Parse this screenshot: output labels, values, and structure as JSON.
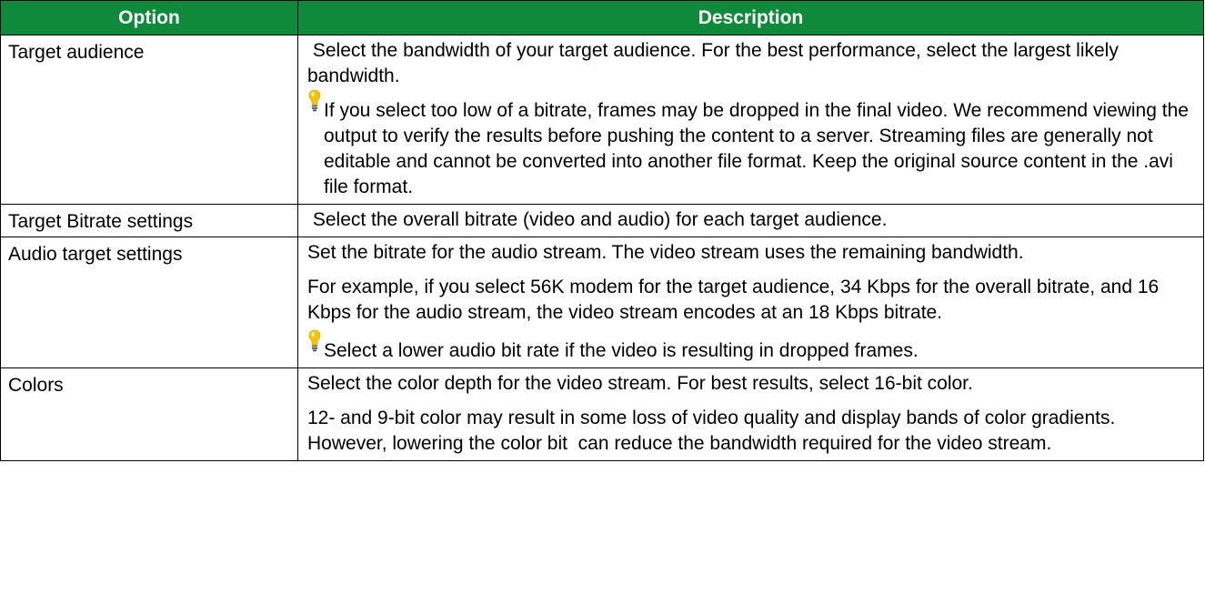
{
  "header": {
    "option": "Option",
    "description": "Description"
  },
  "rows": [
    {
      "option": "Target audience",
      "paragraphs": [
        " Select the bandwidth of your target audience. For the best performance, select the largest likely bandwidth."
      ],
      "tip": "If you select too low of a bitrate, frames may be dropped in the final video. We recommend viewing the output to verify the results before pushing the content to a server. Streaming files are generally not editable and cannot be converted into another file format. Keep the original source content in the .avi file format."
    },
    {
      "option": "Target Bitrate settings",
      "paragraphs": [
        " Select the overall bitrate (video and audio) for each target audience."
      ]
    },
    {
      "option": "Audio target settings",
      "paragraphs": [
        "Set the bitrate for the audio stream. The video stream uses the remaining bandwidth.",
        "For example, if you select 56K modem for the target audience, 34 Kbps for the overall bitrate, and 16 Kbps for the audio stream, the video stream encodes at an 18 Kbps bitrate."
      ],
      "tip": "Select a lower audio bit rate if the video is resulting in dropped frames."
    },
    {
      "option": "Colors",
      "paragraphs": [
        "Select the color depth for the video stream. For best results, select 16-bit color.",
        "12- and 9-bit color may result in some loss of video quality and display bands of color gradients. However, lowering the color bit  can reduce the bandwidth required for the video stream."
      ]
    }
  ],
  "colors": {
    "header_bg": "#0f8a3b",
    "header_text": "#ffffff",
    "border": "#000000",
    "tip_bulb": "#f2c500"
  },
  "icons": {
    "tip": "lightbulb-icon"
  }
}
